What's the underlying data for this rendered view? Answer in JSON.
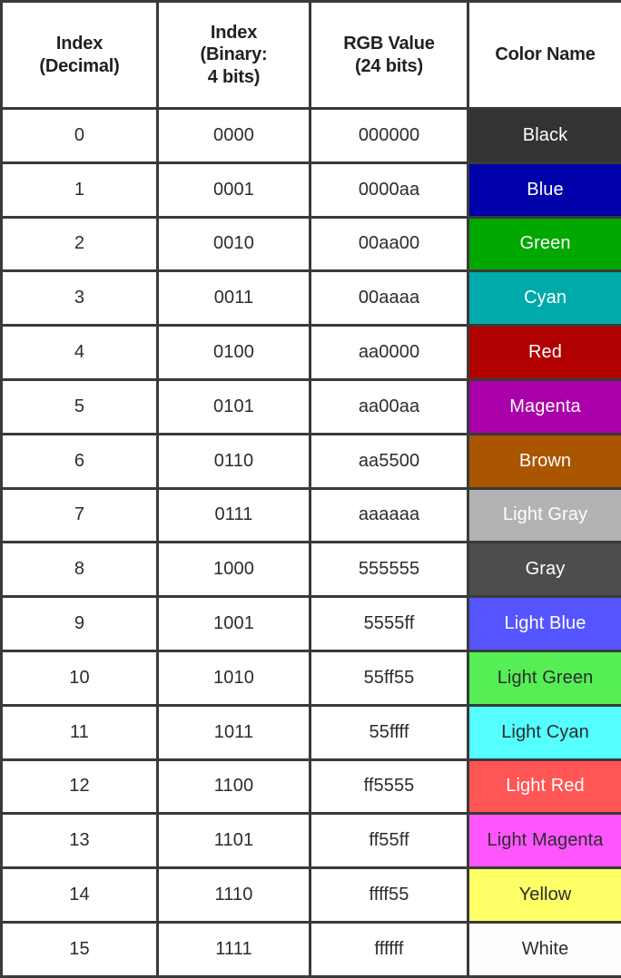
{
  "table": {
    "headers": [
      {
        "line1": "Index",
        "line2": "(Decimal)"
      },
      {
        "line1": "Index",
        "line2": "(Binary:",
        "line3": "4 bits)"
      },
      {
        "line1": "RGB Value",
        "line2": "(24 bits)"
      },
      {
        "line1": "Color Name"
      }
    ],
    "rows": [
      {
        "index": "0",
        "binary": "0000",
        "rgb": "000000",
        "name": "Black",
        "swatch_color": "#333333",
        "text_color": "#ffffff"
      },
      {
        "index": "1",
        "binary": "0001",
        "rgb": "0000aa",
        "name": "Blue",
        "swatch_color": "#0000aa",
        "text_color": "#ffffff"
      },
      {
        "index": "2",
        "binary": "0010",
        "rgb": "00aa00",
        "name": "Green",
        "swatch_color": "#00a800",
        "text_color": "#ffffff"
      },
      {
        "index": "3",
        "binary": "0011",
        "rgb": "00aaaa",
        "name": "Cyan",
        "swatch_color": "#00aaaa",
        "text_color": "#ffffff"
      },
      {
        "index": "4",
        "binary": "0100",
        "rgb": "aa0000",
        "name": "Red",
        "swatch_color": "#b00000",
        "text_color": "#ffffff"
      },
      {
        "index": "5",
        "binary": "0101",
        "rgb": "aa00aa",
        "name": "Magenta",
        "swatch_color": "#aa00aa",
        "text_color": "#ffffff"
      },
      {
        "index": "6",
        "binary": "0110",
        "rgb": "aa5500",
        "name": "Brown",
        "swatch_color": "#aa5500",
        "text_color": "#ffffff"
      },
      {
        "index": "7",
        "binary": "0111",
        "rgb": "aaaaaa",
        "name": "Light Gray",
        "swatch_color": "#b3b3b3",
        "text_color": "#ffffff"
      },
      {
        "index": "8",
        "binary": "1000",
        "rgb": "555555",
        "name": "Gray",
        "swatch_color": "#4d4d4d",
        "text_color": "#ffffff"
      },
      {
        "index": "9",
        "binary": "1001",
        "rgb": "5555ff",
        "name": "Light Blue",
        "swatch_color": "#5555ff",
        "text_color": "#ffffff"
      },
      {
        "index": "10",
        "binary": "1010",
        "rgb": "55ff55",
        "name": "Light Green",
        "swatch_color": "#55ee55",
        "text_color": "#2c2c2c"
      },
      {
        "index": "11",
        "binary": "1011",
        "rgb": "55ffff",
        "name": "Light Cyan",
        "swatch_color": "#55ffff",
        "text_color": "#2c2c2c"
      },
      {
        "index": "12",
        "binary": "1100",
        "rgb": "ff5555",
        "name": "Light Red",
        "swatch_color": "#ff5555",
        "text_color": "#ffffff"
      },
      {
        "index": "13",
        "binary": "1101",
        "rgb": "ff55ff",
        "name": "Light Magenta",
        "swatch_color": "#ff55ff",
        "text_color": "#2c2c2c"
      },
      {
        "index": "14",
        "binary": "1110",
        "rgb": "ffff55",
        "name": "Yellow",
        "swatch_color": "#ffff66",
        "text_color": "#2c2c2c"
      },
      {
        "index": "15",
        "binary": "1111",
        "rgb": "ffffff",
        "name": "White",
        "swatch_color": "#fdfdfd",
        "text_color": "#2c2c2c"
      }
    ]
  }
}
